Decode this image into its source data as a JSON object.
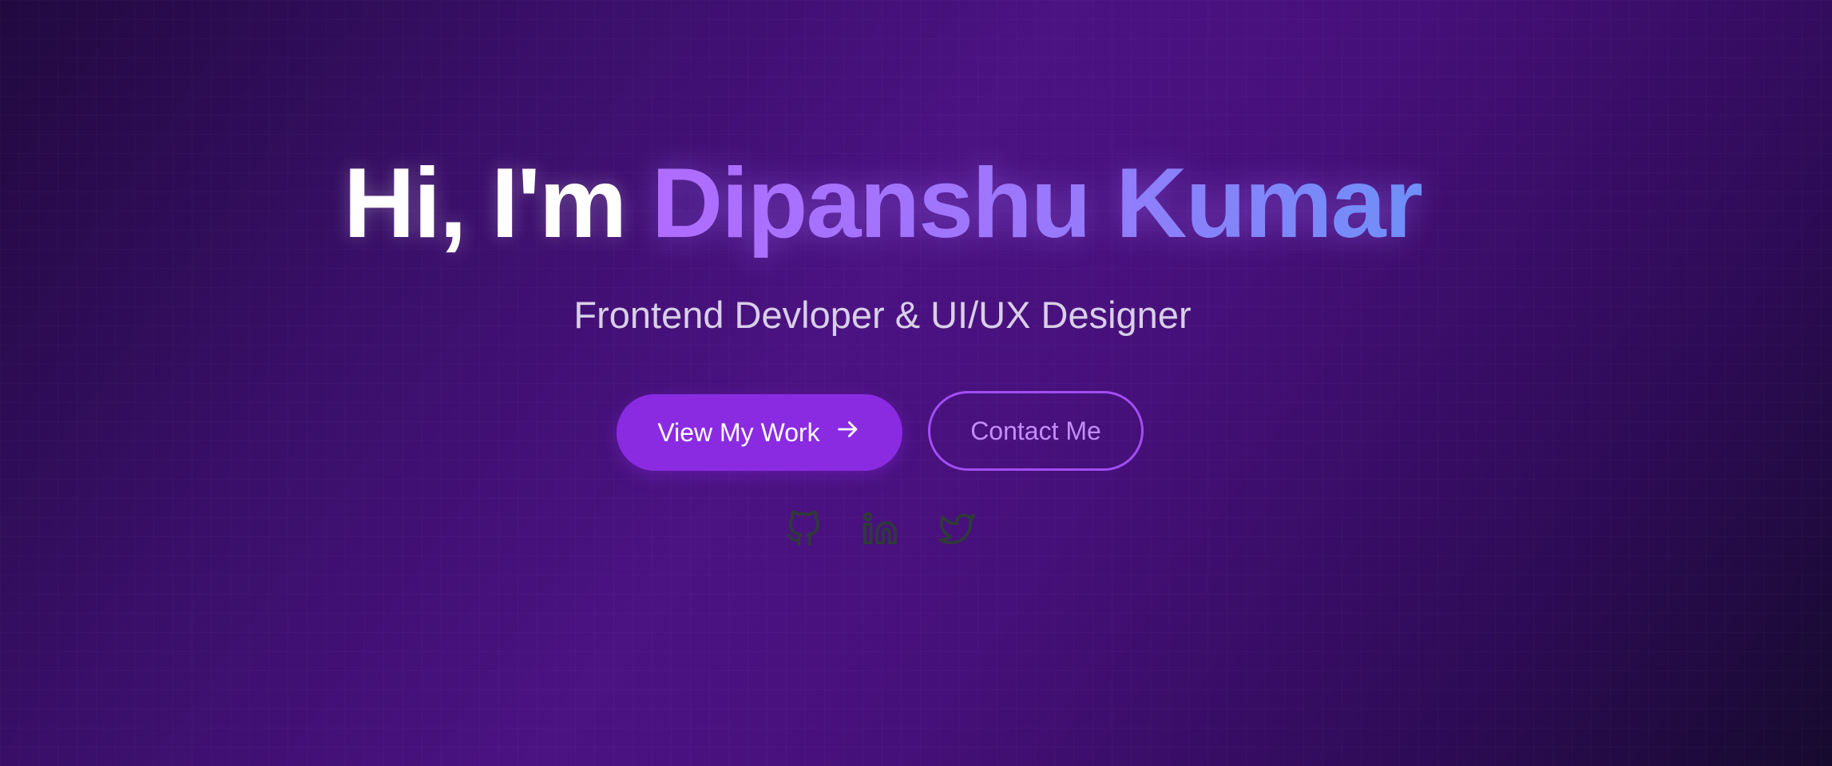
{
  "hero": {
    "greeting": "Hi, I'm ",
    "name": "Dipanshu Kumar",
    "subtitle": "Frontend Devloper & UI/UX Designer"
  },
  "buttons": {
    "primary_label": "View My Work",
    "primary_icon": "arrow-right-icon",
    "secondary_label": "Contact Me"
  },
  "socials": [
    {
      "icon": "github-icon"
    },
    {
      "icon": "linkedin-icon"
    },
    {
      "icon": "twitter-icon"
    }
  ],
  "colors": {
    "accent": "#8a2be2",
    "name_gradient_start": "#b06cff",
    "name_gradient_end": "#6f8ff7",
    "outline": "#a24df5"
  }
}
